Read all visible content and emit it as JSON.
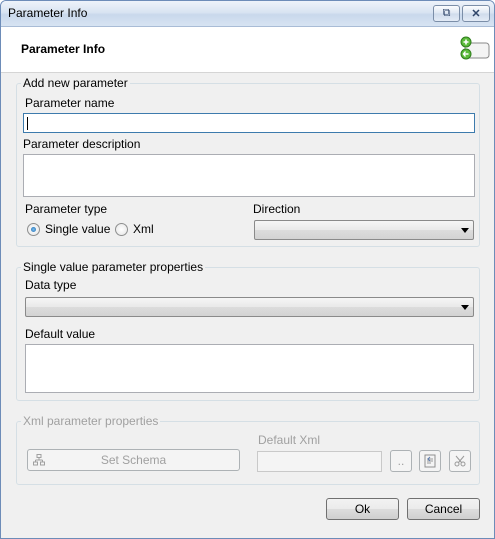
{
  "window": {
    "title": "Parameter Info",
    "restore_glyph": "⧉",
    "close_glyph": "✕"
  },
  "header": {
    "title": "Parameter Info",
    "icon": "parameter-add-icon"
  },
  "new_parameter": {
    "legend": "Add new parameter",
    "name_label": "Parameter name",
    "name_value": "",
    "description_label": "Parameter description",
    "description_value": "",
    "type_label": "Parameter type",
    "type_options": [
      "Single value",
      "Xml"
    ],
    "type_selected": "Single value",
    "direction_label": "Direction",
    "direction_value": ""
  },
  "single_value": {
    "legend": "Single value parameter properties",
    "data_type_label": "Data type",
    "data_type_value": "",
    "default_value_label": "Default value",
    "default_value": ""
  },
  "xml": {
    "legend": "Xml parameter properties",
    "set_schema_label": "Set Schema",
    "default_xml_label": "Default Xml",
    "default_xml_value": "",
    "browse_label": ".."
  },
  "footer": {
    "ok_label": "Ok",
    "cancel_label": "Cancel"
  }
}
